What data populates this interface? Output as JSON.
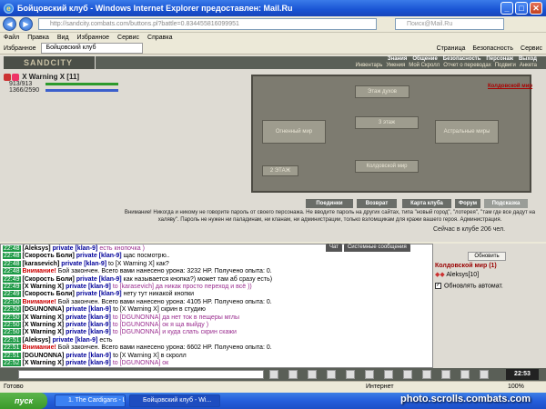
{
  "window": {
    "title": "Бойцовский клуб - Windows Internet Explorer предоставлен: Mail.Ru"
  },
  "address": {
    "url": "http://sandcity.combats.com/buttons.pl?battle=0.834455816099951",
    "search_placeholder": "Поиск@Mail.Ru"
  },
  "menu": [
    "Файл",
    "Правка",
    "Вид",
    "Избранное",
    "Сервис",
    "Справка"
  ],
  "favorites": {
    "label": "Избранное",
    "tab": "Бойцовский клуб",
    "tools": [
      "Страница",
      "Безопасность",
      "Сервис"
    ]
  },
  "game": {
    "logo": "SANDCITY",
    "top_menu": [
      "Знания",
      "Общение",
      "Безопасность",
      "Персонаж",
      "Выход"
    ],
    "sub_menu": [
      "Инвентарь",
      "Умения",
      "Мой Скролл",
      "Отчет о переводах",
      "Подвиги",
      "Анкета"
    ],
    "character": {
      "name": "X Warning X [11]",
      "hp": "913/913",
      "mana": "1366/2590"
    },
    "map_labels": [
      "Этаж духов",
      "Огненный мир",
      "3 этаж",
      "Астральные миры",
      "Колдовской мир",
      "2 ЭТАЖ"
    ],
    "location_link": "Колдовской мир",
    "buttons": [
      "Поединки",
      "Возврат",
      "Карта клуба",
      "Форум",
      "Подсказка"
    ],
    "warning": "Внимание! Никогда и никому не говорите пароль от своего персонажа. Не вводите пароль на других сайтах, типа \"новый город\", \"лотерея\", \"там где все дадут на халяву\". Пароль не нужен ни паладинам, ни кланам, ни администрации, только взломщикам для кражи вашего героя. Администрация.",
    "online": "Сейчас в клубе 206 чел."
  },
  "chat": {
    "tabs": [
      "Чат",
      "Системные сообщения"
    ],
    "lines": [
      {
        "time": "22:48",
        "nick": "[Aleksys]",
        "priv": "private [klan-9]",
        "text": "есть кнопочка )",
        "style": "pink"
      },
      {
        "time": "22:48",
        "nick": "[Скорость Боли]",
        "priv": "private [klan-9]",
        "text": "щас посмотрю..",
        "style": ""
      },
      {
        "time": "22:48",
        "nick": "[karasevich]",
        "priv": "private [klan-9]",
        "text": "to [X Warning X] как?",
        "style": ""
      },
      {
        "time": "22:48",
        "nick": "Внимание!",
        "priv": "",
        "text": "Бой закончен. Всего вами нанесено урона: 3232 HP. Получено опыта: 0.",
        "style": "sys"
      },
      {
        "time": "22:49",
        "nick": "[Скорость Боли]",
        "priv": "private [klan-9]",
        "text": "как называется кнопка?) может там аб сразу есть)",
        "style": ""
      },
      {
        "time": "22:49",
        "nick": "[X Warning X]",
        "priv": "private [klan-9]",
        "text": "to [karasevich] да никак просто переход и всё ))",
        "style": "pink"
      },
      {
        "time": "22:49",
        "nick": "[Скорость Боли]",
        "priv": "private [klan-9]",
        "text": "нету тут никакой кнопки",
        "style": ""
      },
      {
        "time": "22:50",
        "nick": "Внимание!",
        "priv": "",
        "text": "Бой закончен. Всего вами нанесено урона: 4105 HP. Получено опыта: 0.",
        "style": "sys"
      },
      {
        "time": "22:50",
        "nick": "[DGUNONNA]",
        "priv": "private [klan-9]",
        "text": "to [X Warning X] скрин в студию",
        "style": ""
      },
      {
        "time": "22:50",
        "nick": "[X Warning X]",
        "priv": "private [klan-9]",
        "text": "to [DGUNONNA] да нет ток в пещеры мглы",
        "style": "pink"
      },
      {
        "time": "22:50",
        "nick": "[X Warning X]",
        "priv": "private [klan-9]",
        "text": "to [DGUNONNA] ок я ща выйду )",
        "style": "pink"
      },
      {
        "time": "22:50",
        "nick": "[X Warning X]",
        "priv": "private [klan-9]",
        "text": "to [DGUNONNA] и куда слать скрин скажи",
        "style": "pink"
      },
      {
        "time": "22:51",
        "nick": "[Aleksys]",
        "priv": "private [klan-9]",
        "text": "есть",
        "style": ""
      },
      {
        "time": "22:51",
        "nick": "Внимание!",
        "priv": "",
        "text": "Бой закончен. Всего вами нанесено урона: 6602 HP. Получено опыта: 0.",
        "style": "sys"
      },
      {
        "time": "22:51",
        "nick": "[DGUNONNA]",
        "priv": "private [klan-9]",
        "text": "to [X Warning X] в скролл",
        "style": ""
      },
      {
        "time": "22:52",
        "nick": "[X Warning X]",
        "priv": "private [klan-9]",
        "text": "to [DGUNONNA] ок",
        "style": "pink"
      }
    ],
    "time": "22:53"
  },
  "room": {
    "refresh": "Обновить",
    "title": "Колдовской мир (1)",
    "member": "Aleksys[10]",
    "auto_label": "Обновлять автомат."
  },
  "status": {
    "left": "Готово",
    "zone": "Интернет",
    "zoom": "100%"
  },
  "taskbar": {
    "start": "пуск",
    "tasks": [
      "1. The Cardigans - Lo...",
      "Бойцовский клуб - Wi..."
    ]
  },
  "watermark": "photo.scrolls.combats.com"
}
